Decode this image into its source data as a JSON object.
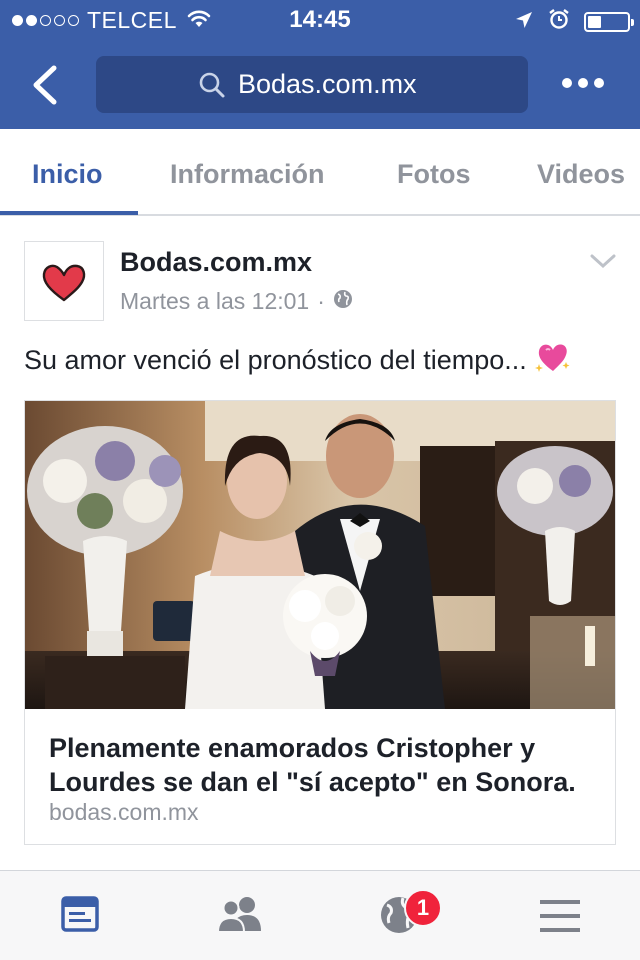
{
  "status_bar": {
    "carrier": "TELCEL",
    "time": "14:45",
    "signal_bars": 2,
    "battery_level": 0.35
  },
  "navbar": {
    "search_text": "Bodas.com.mx"
  },
  "tabs": [
    {
      "label": "Inicio",
      "active": true
    },
    {
      "label": "Información",
      "active": false
    },
    {
      "label": "Fotos",
      "active": false
    },
    {
      "label": "Videos",
      "active": false
    }
  ],
  "post": {
    "page_name": "Bodas.com.mx",
    "timestamp": "Martes a las 12:01",
    "separator": "·",
    "text": "Su amor venció el pronóstico del tiempo...",
    "emoji": "sparkling-heart-icon",
    "link": {
      "title": "Plenamente enamorados Cristopher y Lourdes se dan el \"sí acepto\" en Sonora.",
      "domain": "bodas.com.mx"
    }
  },
  "bottom_bar": {
    "items": [
      "news-feed-icon",
      "friends-icon",
      "notifications-globe-icon",
      "menu-icon"
    ],
    "notification_count": "1"
  },
  "colors": {
    "brand_blue": "#3b5ea8",
    "search_bg": "#2d4886",
    "badge_red": "#f0233b",
    "muted_text": "#90949c"
  }
}
